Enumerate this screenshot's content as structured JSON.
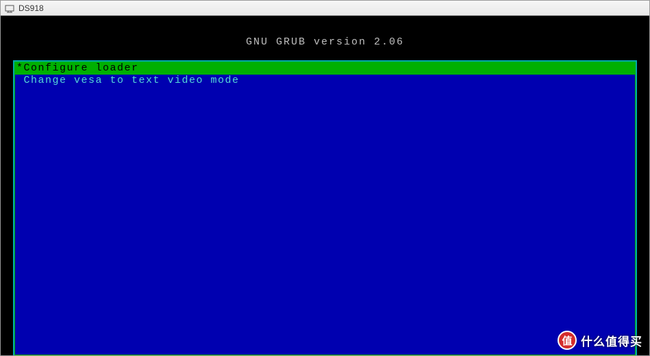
{
  "window": {
    "title": "DS918"
  },
  "grub": {
    "header": "GNU GRUB  version 2.06",
    "menu": [
      {
        "marker": "*",
        "label": "Configure loader",
        "selected": true
      },
      {
        "marker": " ",
        "label": "Change vesa to text video mode",
        "selected": false
      }
    ]
  },
  "watermark": {
    "badge": "值",
    "text": "什么值得买"
  }
}
